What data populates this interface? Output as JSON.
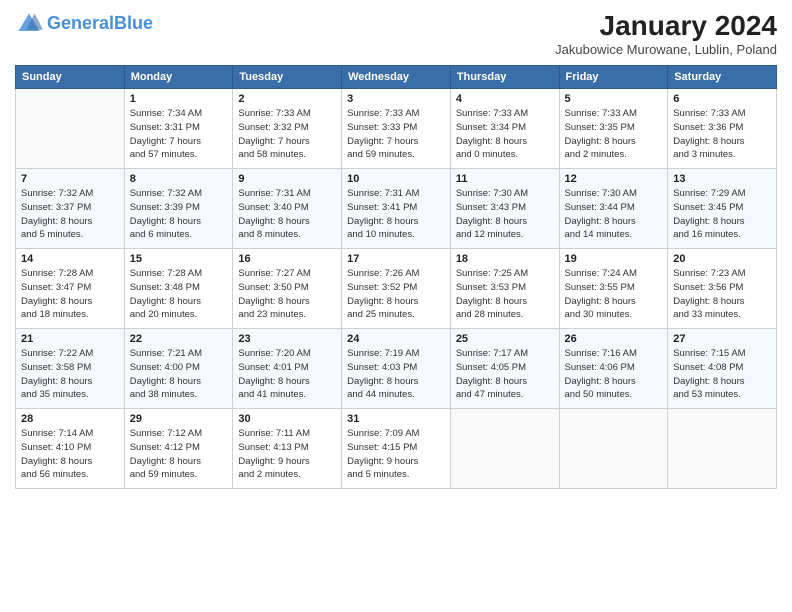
{
  "header": {
    "logo_line1": "General",
    "logo_line2": "Blue",
    "month_title": "January 2024",
    "location": "Jakubowice Murowane, Lublin, Poland"
  },
  "weekdays": [
    "Sunday",
    "Monday",
    "Tuesday",
    "Wednesday",
    "Thursday",
    "Friday",
    "Saturday"
  ],
  "weeks": [
    [
      {
        "day": "",
        "info": ""
      },
      {
        "day": "1",
        "info": "Sunrise: 7:34 AM\nSunset: 3:31 PM\nDaylight: 7 hours\nand 57 minutes."
      },
      {
        "day": "2",
        "info": "Sunrise: 7:33 AM\nSunset: 3:32 PM\nDaylight: 7 hours\nand 58 minutes."
      },
      {
        "day": "3",
        "info": "Sunrise: 7:33 AM\nSunset: 3:33 PM\nDaylight: 7 hours\nand 59 minutes."
      },
      {
        "day": "4",
        "info": "Sunrise: 7:33 AM\nSunset: 3:34 PM\nDaylight: 8 hours\nand 0 minutes."
      },
      {
        "day": "5",
        "info": "Sunrise: 7:33 AM\nSunset: 3:35 PM\nDaylight: 8 hours\nand 2 minutes."
      },
      {
        "day": "6",
        "info": "Sunrise: 7:33 AM\nSunset: 3:36 PM\nDaylight: 8 hours\nand 3 minutes."
      }
    ],
    [
      {
        "day": "7",
        "info": "Sunrise: 7:32 AM\nSunset: 3:37 PM\nDaylight: 8 hours\nand 5 minutes."
      },
      {
        "day": "8",
        "info": "Sunrise: 7:32 AM\nSunset: 3:39 PM\nDaylight: 8 hours\nand 6 minutes."
      },
      {
        "day": "9",
        "info": "Sunrise: 7:31 AM\nSunset: 3:40 PM\nDaylight: 8 hours\nand 8 minutes."
      },
      {
        "day": "10",
        "info": "Sunrise: 7:31 AM\nSunset: 3:41 PM\nDaylight: 8 hours\nand 10 minutes."
      },
      {
        "day": "11",
        "info": "Sunrise: 7:30 AM\nSunset: 3:43 PM\nDaylight: 8 hours\nand 12 minutes."
      },
      {
        "day": "12",
        "info": "Sunrise: 7:30 AM\nSunset: 3:44 PM\nDaylight: 8 hours\nand 14 minutes."
      },
      {
        "day": "13",
        "info": "Sunrise: 7:29 AM\nSunset: 3:45 PM\nDaylight: 8 hours\nand 16 minutes."
      }
    ],
    [
      {
        "day": "14",
        "info": "Sunrise: 7:28 AM\nSunset: 3:47 PM\nDaylight: 8 hours\nand 18 minutes."
      },
      {
        "day": "15",
        "info": "Sunrise: 7:28 AM\nSunset: 3:48 PM\nDaylight: 8 hours\nand 20 minutes."
      },
      {
        "day": "16",
        "info": "Sunrise: 7:27 AM\nSunset: 3:50 PM\nDaylight: 8 hours\nand 23 minutes."
      },
      {
        "day": "17",
        "info": "Sunrise: 7:26 AM\nSunset: 3:52 PM\nDaylight: 8 hours\nand 25 minutes."
      },
      {
        "day": "18",
        "info": "Sunrise: 7:25 AM\nSunset: 3:53 PM\nDaylight: 8 hours\nand 28 minutes."
      },
      {
        "day": "19",
        "info": "Sunrise: 7:24 AM\nSunset: 3:55 PM\nDaylight: 8 hours\nand 30 minutes."
      },
      {
        "day": "20",
        "info": "Sunrise: 7:23 AM\nSunset: 3:56 PM\nDaylight: 8 hours\nand 33 minutes."
      }
    ],
    [
      {
        "day": "21",
        "info": "Sunrise: 7:22 AM\nSunset: 3:58 PM\nDaylight: 8 hours\nand 35 minutes."
      },
      {
        "day": "22",
        "info": "Sunrise: 7:21 AM\nSunset: 4:00 PM\nDaylight: 8 hours\nand 38 minutes."
      },
      {
        "day": "23",
        "info": "Sunrise: 7:20 AM\nSunset: 4:01 PM\nDaylight: 8 hours\nand 41 minutes."
      },
      {
        "day": "24",
        "info": "Sunrise: 7:19 AM\nSunset: 4:03 PM\nDaylight: 8 hours\nand 44 minutes."
      },
      {
        "day": "25",
        "info": "Sunrise: 7:17 AM\nSunset: 4:05 PM\nDaylight: 8 hours\nand 47 minutes."
      },
      {
        "day": "26",
        "info": "Sunrise: 7:16 AM\nSunset: 4:06 PM\nDaylight: 8 hours\nand 50 minutes."
      },
      {
        "day": "27",
        "info": "Sunrise: 7:15 AM\nSunset: 4:08 PM\nDaylight: 8 hours\nand 53 minutes."
      }
    ],
    [
      {
        "day": "28",
        "info": "Sunrise: 7:14 AM\nSunset: 4:10 PM\nDaylight: 8 hours\nand 56 minutes."
      },
      {
        "day": "29",
        "info": "Sunrise: 7:12 AM\nSunset: 4:12 PM\nDaylight: 8 hours\nand 59 minutes."
      },
      {
        "day": "30",
        "info": "Sunrise: 7:11 AM\nSunset: 4:13 PM\nDaylight: 9 hours\nand 2 minutes."
      },
      {
        "day": "31",
        "info": "Sunrise: 7:09 AM\nSunset: 4:15 PM\nDaylight: 9 hours\nand 5 minutes."
      },
      {
        "day": "",
        "info": ""
      },
      {
        "day": "",
        "info": ""
      },
      {
        "day": "",
        "info": ""
      }
    ]
  ]
}
